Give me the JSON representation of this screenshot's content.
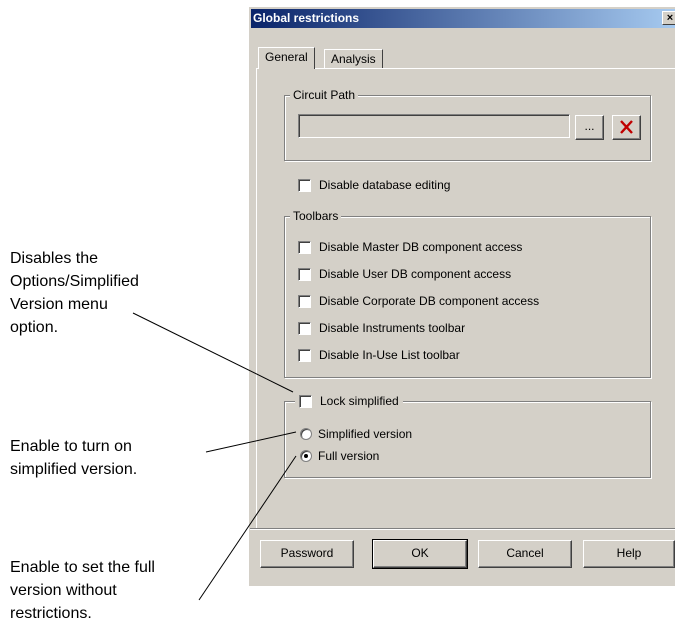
{
  "callouts": {
    "simplified_menu": [
      "Disables the",
      "Options/Simplified",
      "Version menu",
      "option."
    ],
    "turn_on_simplified": [
      "Enable to turn on",
      "simplified version."
    ],
    "full_version": [
      "Enable to set the full",
      "version without",
      "restrictions."
    ]
  },
  "dialog": {
    "title": "Global restrictions",
    "close_glyph": "×",
    "tabs": [
      {
        "label": "General",
        "active": true
      },
      {
        "label": "Analysis",
        "active": false
      }
    ],
    "circuit_path": {
      "legend": "Circuit Path",
      "value": "",
      "browse_label": "...",
      "clear_icon": "red-x-icon"
    },
    "disable_db_editing": {
      "label": "Disable database editing",
      "checked": false
    },
    "toolbars": {
      "legend": "Toolbars",
      "items": [
        {
          "label": "Disable Master DB component access",
          "checked": false
        },
        {
          "label": "Disable User DB component access",
          "checked": false
        },
        {
          "label": "Disable Corporate DB component access",
          "checked": false
        },
        {
          "label": "Disable Instruments toolbar",
          "checked": false
        },
        {
          "label": "Disable In-Use List toolbar",
          "checked": false
        }
      ]
    },
    "lock_simplified": {
      "label": "Lock simplified",
      "checked": false
    },
    "version": {
      "options": [
        {
          "label": "Simplified version",
          "selected": false
        },
        {
          "label": "Full version",
          "selected": true
        }
      ]
    },
    "buttons": {
      "password": "Password",
      "ok": "OK",
      "cancel": "Cancel",
      "help": "Help"
    }
  }
}
